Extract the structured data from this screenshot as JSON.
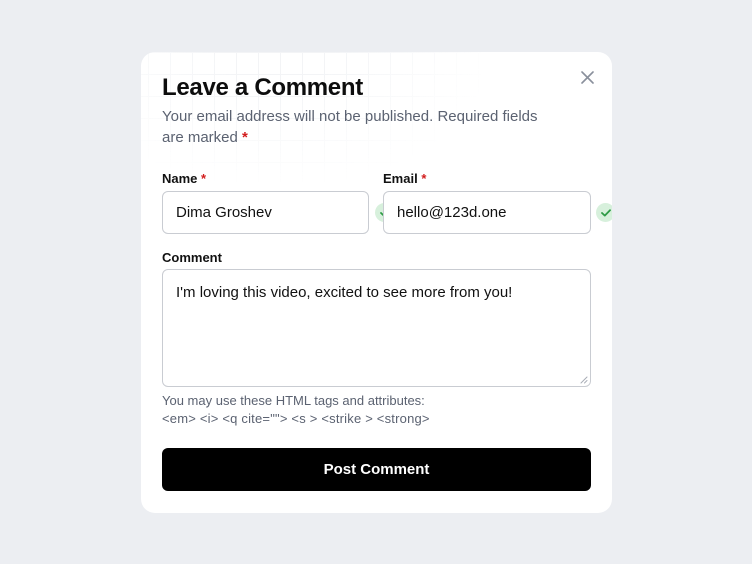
{
  "modal": {
    "title": "Leave a Comment",
    "subtitle": "Your email address will not be published. Required fields are marked",
    "required_marker": "*",
    "close_icon": "close-icon"
  },
  "form": {
    "name": {
      "label": "Name",
      "required": "*",
      "value": "Dima Groshev",
      "status_icon": "check-icon"
    },
    "email": {
      "label": "Email",
      "required": "*",
      "value": "hello@123d.one",
      "status_icon": "check-icon"
    },
    "comment": {
      "label": "Comment",
      "value": "I'm loving this video, excited to see more from you!"
    },
    "hint_line1": "You may use these HTML tags and attributes:",
    "hint_line2": "<em> <i> <q cite=\"\"> <s > <strike > <strong>",
    "submit_label": "Post Comment"
  },
  "colors": {
    "background": "#eceef2",
    "required": "#d21c1c",
    "valid_badge": "#d7f0dc",
    "valid_check": "#2f9b46",
    "button": "#000000"
  }
}
